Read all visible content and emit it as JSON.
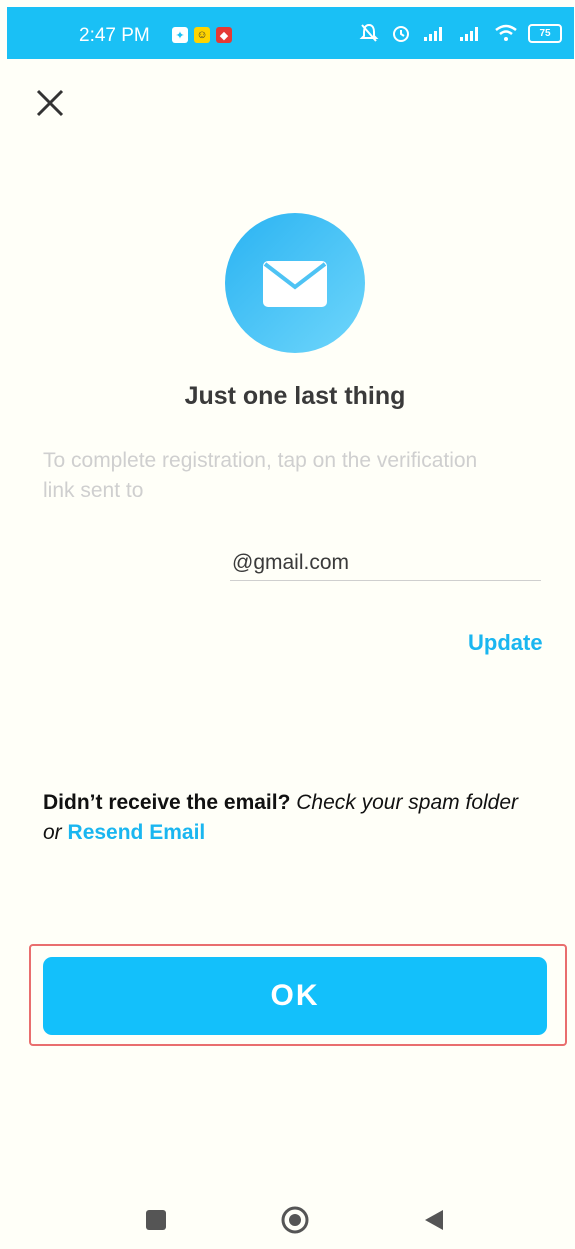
{
  "status_bar": {
    "time": "2:47 PM",
    "battery": "75"
  },
  "dialog": {
    "title": "Just one last thing",
    "description": "To complete registration, tap on the verification link sent to",
    "email": "@gmail.com",
    "update_label": "Update",
    "resend_question": "Didn’t receive the email?",
    "resend_hint": "Check your spam folder or",
    "resend_link": "Resend Email",
    "ok_label": "OK"
  },
  "colors": {
    "accent": "#1ab6f0",
    "status_bar": "#1ac0f5",
    "highlight": "#e96e6e"
  },
  "icons": [
    "close-icon",
    "mail-icon",
    "recent-apps-icon",
    "home-icon",
    "back-icon"
  ]
}
